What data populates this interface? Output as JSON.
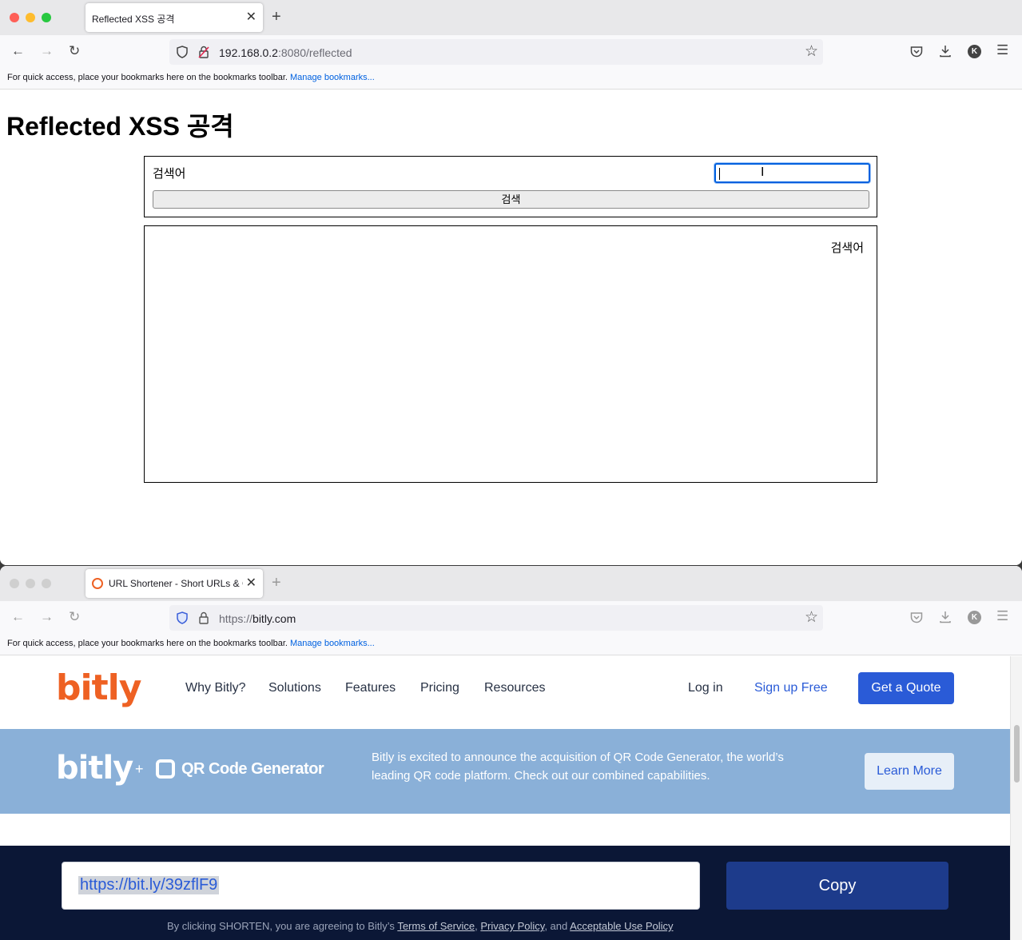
{
  "window1": {
    "tab_title": "Reflected XSS 공격",
    "url_host": "192.168.0.2",
    "url_rest": ":8080/reflected",
    "bookmarks_text": "For quick access, place your bookmarks here on the bookmarks toolbar.",
    "bookmarks_link": "Manage bookmarks...",
    "page": {
      "title": "Reflected XSS 공격",
      "search_label": "검색어",
      "search_value": "",
      "search_button": "검색",
      "table_header": "검색어"
    }
  },
  "window2": {
    "tab_title": "URL Shortener - Short URLs & Custom Free Link Shortener | Bitly",
    "url_scheme": "https://",
    "url_host": "bitly.com",
    "bookmarks_text": "For quick access, place your bookmarks here on the bookmarks toolbar.",
    "bookmarks_link": "Manage bookmarks...",
    "site": {
      "logo": "bitly",
      "nav": [
        "Why Bitly?",
        "Solutions",
        "Features",
        "Pricing",
        "Resources"
      ],
      "login": "Log in",
      "signup": "Sign up Free",
      "quote": "Get a Quote",
      "banner_logo": "bitly",
      "banner_plus": "+",
      "banner_partner": "QR Code Generator",
      "banner_text": "Bitly is excited to announce the acquisition of QR Code Generator, the world’s leading QR code platform. Check out our combined capabilities.",
      "learn_more": "Learn More",
      "short_url": "https://bit.ly/39zflF9",
      "copy": "Copy",
      "legal_prefix": "By clicking SHORTEN, you are agreeing to Bitly’s",
      "terms": "Terms of Service",
      "comma": ",",
      "privacy": "Privacy Policy",
      "and": ", and",
      "aup": "Acceptable Use Policy"
    }
  },
  "colors": {
    "bitly_orange": "#ee6123",
    "bitly_blue": "#2a5bd7",
    "banner_blue": "#8ab0d8",
    "footer_navy": "#0b1736"
  },
  "icons": [
    "back-icon",
    "forward-icon",
    "reload-icon",
    "shield-icon",
    "lock-icon",
    "star-icon",
    "pocket-icon",
    "download-icon",
    "account-icon",
    "menu-icon",
    "close-icon",
    "plus-icon",
    "bitly-favicon"
  ]
}
